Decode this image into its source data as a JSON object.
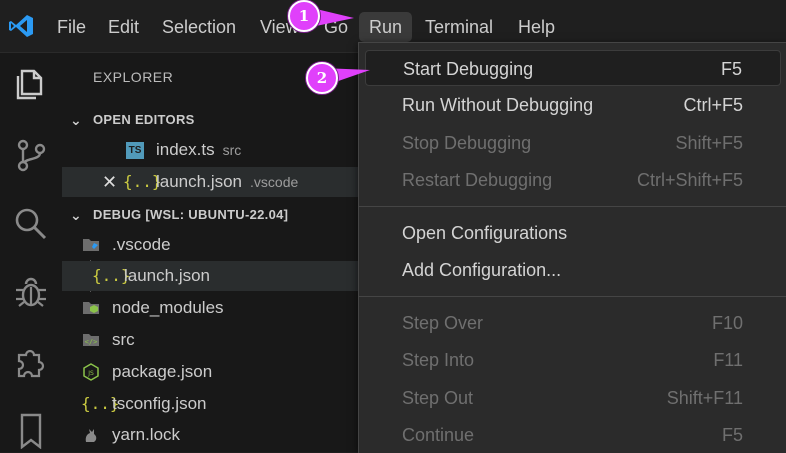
{
  "menubar": {
    "items": [
      "File",
      "Edit",
      "Selection",
      "View",
      "Go",
      "Run",
      "Terminal",
      "Help"
    ],
    "active": "Run"
  },
  "sidebar": {
    "title": "EXPLORER",
    "open_editors": {
      "header": "OPEN EDITORS",
      "files": [
        {
          "badge": "TS",
          "name": "index.ts",
          "folder": "src"
        },
        {
          "close": "✕",
          "badge": "{..}",
          "name": "launch.json",
          "folder": ".vscode"
        }
      ]
    },
    "workspace": {
      "header": "DEBUG [WSL: UBUNTU-22.04]",
      "items": [
        {
          "name": ".vscode",
          "badge": ""
        },
        {
          "name": "launch.json",
          "badge": "{..}"
        },
        {
          "name": "node_modules",
          "badge": ""
        },
        {
          "name": "src",
          "badge": "</>"
        },
        {
          "name": "package.json",
          "badge": "JS"
        },
        {
          "name": "tsconfig.json",
          "badge": "{..}"
        },
        {
          "name": "yarn.lock",
          "badge": ""
        }
      ]
    }
  },
  "run_menu": {
    "groups": [
      [
        {
          "label": "Start Debugging",
          "key": "F5",
          "enabled": true
        },
        {
          "label": "Run Without Debugging",
          "key": "Ctrl+F5",
          "enabled": true
        },
        {
          "label": "Stop Debugging",
          "key": "Shift+F5",
          "enabled": false
        },
        {
          "label": "Restart Debugging",
          "key": "Ctrl+Shift+F5",
          "enabled": false
        }
      ],
      [
        {
          "label": "Open Configurations",
          "key": "",
          "enabled": true
        },
        {
          "label": "Add Configuration...",
          "key": "",
          "enabled": true
        }
      ],
      [
        {
          "label": "Step Over",
          "key": "F10",
          "enabled": false
        },
        {
          "label": "Step Into",
          "key": "F11",
          "enabled": false
        },
        {
          "label": "Step Out",
          "key": "Shift+F11",
          "enabled": false
        },
        {
          "label": "Continue",
          "key": "F5",
          "enabled": false
        }
      ]
    ]
  },
  "annotations": {
    "step1": "1",
    "step2": "2",
    "color": "#e040fb"
  },
  "colors": {
    "accent_blue": "#2b9af3",
    "menu_bg": "#2b2b2b",
    "json_yellow": "#cbcb41",
    "ts_blue": "#519aba"
  }
}
